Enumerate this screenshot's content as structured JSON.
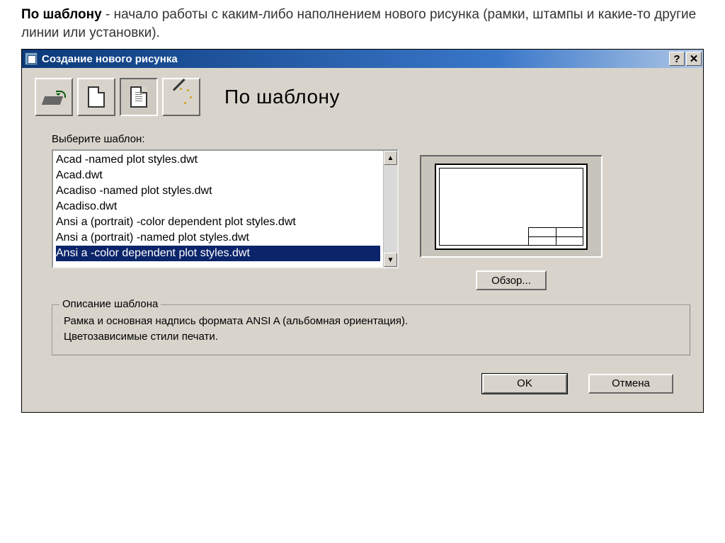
{
  "intro": {
    "bold": "По шаблону",
    "rest": " - начало работы с каким-либо наполнением нового рисунка (рамки, штампы и какие-то другие линии или установки)."
  },
  "dialog": {
    "title": "Создание нового рисунка",
    "heading": "По шаблону",
    "select_label": "Выберите шаблон:",
    "templates": [
      "Acad -named plot styles.dwt",
      "Acad.dwt",
      "Acadiso -named plot styles.dwt",
      "Acadiso.dwt",
      "Ansi a (portrait) -color dependent plot styles.dwt",
      "Ansi a (portrait) -named plot styles.dwt",
      "Ansi a -color dependent plot styles.dwt"
    ],
    "selected_index": 6,
    "browse_label": "Обзор...",
    "description_legend": "Описание шаблона",
    "description_line1": "Рамка и основная надпись формата ANSI A (альбомная ориентация).",
    "description_line2": "Цветозависимые стили печати.",
    "ok_label": "OK",
    "cancel_label": "Отмена",
    "help_symbol": "?",
    "close_symbol": "✕"
  }
}
